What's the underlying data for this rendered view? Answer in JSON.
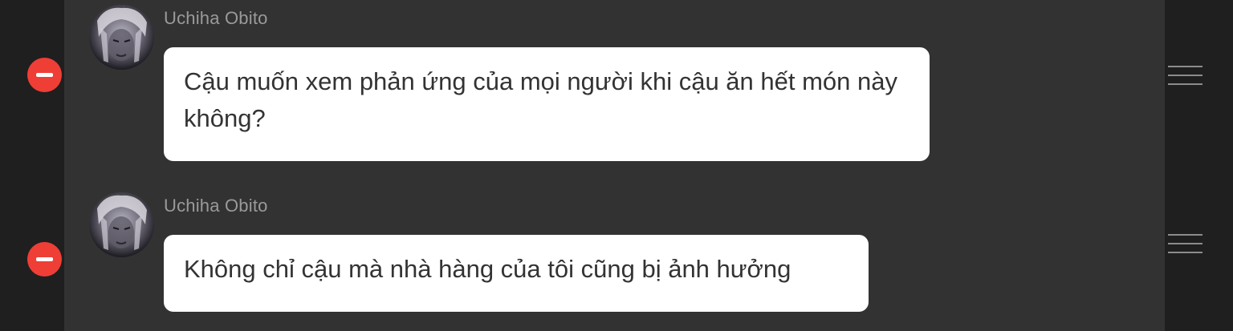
{
  "messages": [
    {
      "sender": "Uchiha Obito",
      "avatar_icon": "avatar-portrait",
      "text": "Cậu muốn xem phản ứng của mọi người khi cậu ăn hết món này không?",
      "delete_icon": "minus-circle-icon",
      "handle_icon": "drag-handle-icon"
    },
    {
      "sender": "Uchiha Obito",
      "avatar_icon": "avatar-portrait",
      "text": "Không chỉ cậu mà nhà hàng của tôi cũng bị ảnh hưởng",
      "delete_icon": "minus-circle-icon",
      "handle_icon": "drag-handle-icon"
    }
  ],
  "colors": {
    "background": "#1f1f1f",
    "panel": "#323232",
    "bubble": "#ffffff",
    "bubble_text": "#333333",
    "sender_text": "#9a9a9a",
    "delete_button": "#ef3e36",
    "handle": "#8c8c8c"
  }
}
